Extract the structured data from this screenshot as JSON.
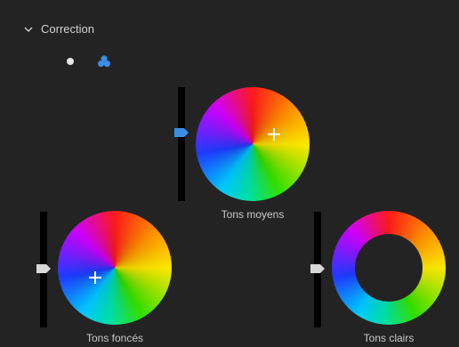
{
  "section": {
    "title": "Correction",
    "collapse_icon": "chevron-down-icon"
  },
  "modes": [
    {
      "name": "single-wheel",
      "icon": "dot-icon"
    },
    {
      "name": "three-wheels",
      "icon": "three-circles-icon",
      "active": true,
      "color": "#3a8ee6"
    }
  ],
  "wheels": {
    "midtones": {
      "label": "Tons moyens",
      "type": "filled"
    },
    "shadows": {
      "label": "Tons foncés",
      "type": "filled"
    },
    "highlights": {
      "label": "Tons clairs",
      "type": "ring"
    }
  },
  "colors": {
    "accent": "#3a8ee6",
    "handle_default": "#d8d8d8",
    "background": "#232323"
  }
}
